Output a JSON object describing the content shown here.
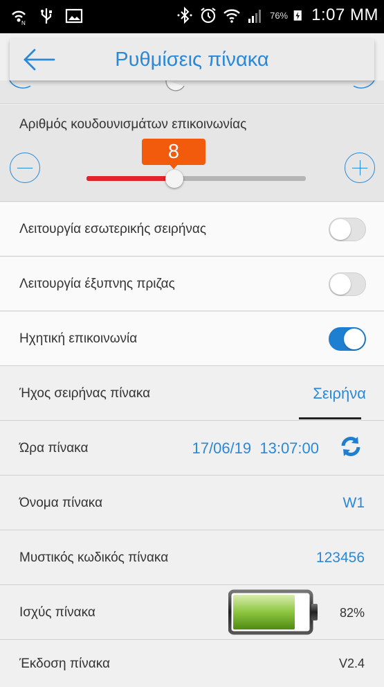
{
  "status_bar": {
    "battery_percent": "76%",
    "time": "1:07 ΜΜ",
    "icons": [
      "hotspot-icon",
      "usb-icon",
      "image-icon",
      "bluetooth-icon",
      "alarm-icon",
      "wifi-icon",
      "signal-icon",
      "battery-charging-icon"
    ]
  },
  "header": {
    "title": "Ρυθμίσεις πίνακα",
    "back_icon": "back-arrow-icon"
  },
  "ring_count": {
    "label": "Αριθμός κουδουνισμάτων επικοινωνίας",
    "value": "8",
    "slider_fraction": 0.4
  },
  "rows": {
    "internal_siren": {
      "label": "Λειτουργία εσωτερικής σειρήνας",
      "on": false
    },
    "smart_plug": {
      "label": "Λειτουργία έξυπνης πριζας",
      "on": false
    },
    "voice_comm": {
      "label": "Ηχητική επικοινωνία",
      "on": true
    },
    "siren_sound": {
      "label": "Ήχος σειρήνας πίνακα",
      "value": "Σειρήνα"
    },
    "panel_time": {
      "label": "Ώρα πίνακα",
      "value": "17/06/19  13:07:00"
    },
    "panel_name": {
      "label": "Όνομα πίνακα",
      "value": "W1"
    },
    "panel_password": {
      "label": "Μυστικός κωδικός πίνακα",
      "value": "123456"
    },
    "panel_power": {
      "label": "Ισχύς πίνακα",
      "value": "82%",
      "battery_fraction": 0.82
    },
    "panel_version": {
      "label": "Έκδοση πίνακα",
      "value": "V2.4"
    }
  },
  "colors": {
    "accent": "#2a88d8",
    "slider_fill": "#e1232d",
    "bubble": "#f25a0c",
    "toggle_on": "#1e7fd1",
    "battery_green": "#8cc63f"
  }
}
